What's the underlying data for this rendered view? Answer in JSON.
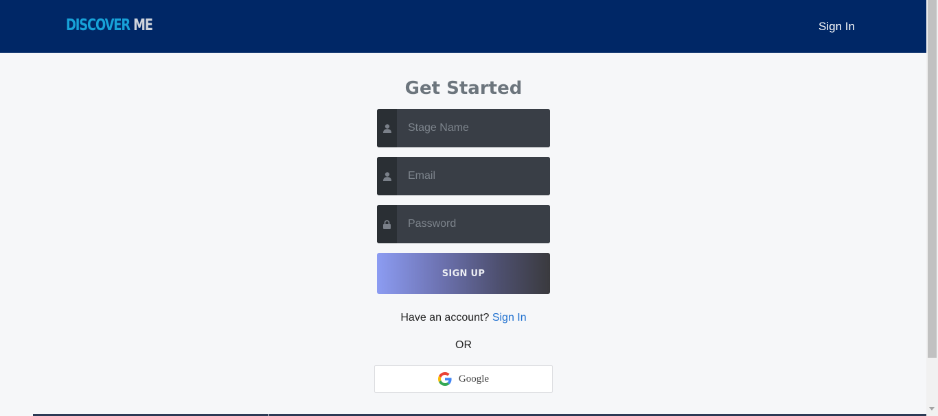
{
  "header": {
    "brand_part1": "DISCOVER",
    "brand_part2": "ME",
    "signin_link": "Sign In"
  },
  "form": {
    "title": "Get Started",
    "stage_name": {
      "placeholder": "Stage Name",
      "icon": "user-icon"
    },
    "email": {
      "placeholder": "Email",
      "icon": "user-icon"
    },
    "password": {
      "placeholder": "Password",
      "icon": "lock-icon"
    },
    "signup_label": "SIGN UP",
    "have_account_text": "Have an account?",
    "signin_link": "Sign In",
    "or_text": "OR",
    "google_label": "Google"
  },
  "colors": {
    "navbar": "#002766",
    "brand_accent": "#17a2d8",
    "link": "#1f70cf"
  }
}
